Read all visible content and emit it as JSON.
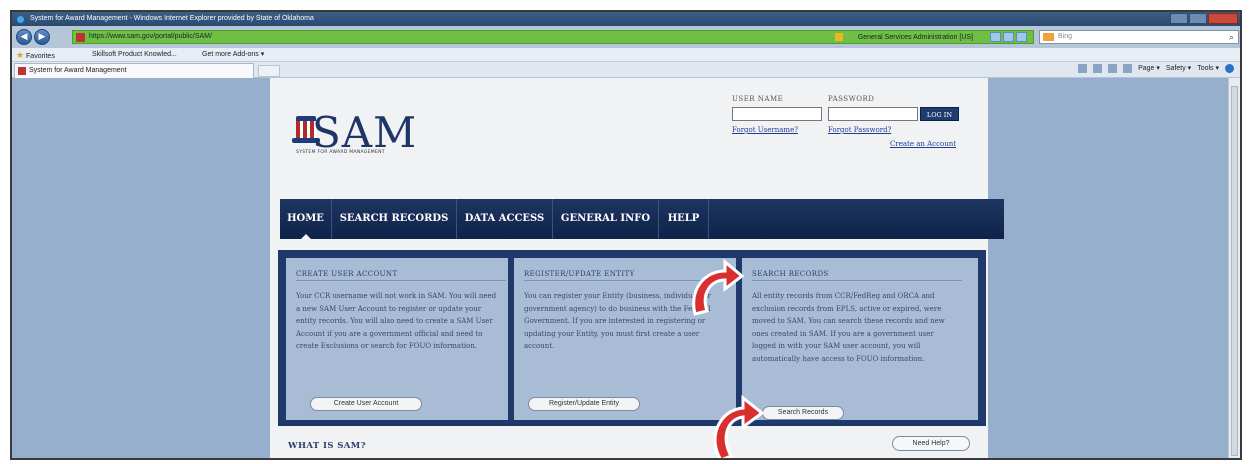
{
  "browser": {
    "title": "System for Award Management - Windows Internet Explorer provided by State of Oklahoma",
    "url": "https://www.sam.gov/portal/public/SAM/",
    "cert_label": "General Services Administration [US]",
    "search_placeholder": "Bing",
    "favorites_label": "Favorites",
    "favorites_items": [
      "Skillsoft Product Knowled...",
      "Get more Add-ons ▾"
    ],
    "tab_title": "System for Award Management",
    "commands": [
      "Page ▾",
      "Safety ▾",
      "Tools ▾"
    ]
  },
  "site": {
    "logo_text": "SAM",
    "logo_subtitle": "SYSTEM FOR AWARD MANAGEMENT",
    "username_label": "USER NAME",
    "password_label": "PASSWORD",
    "login_button": "LOG IN",
    "forgot_username": "Forgot Username?",
    "forgot_password": "Forgot Password?",
    "create_account_link": "Create an Account",
    "nav": [
      "HOME",
      "SEARCH RECORDS",
      "DATA ACCESS",
      "GENERAL INFO",
      "HELP"
    ],
    "columns": [
      {
        "heading": "CREATE USER ACCOUNT",
        "body": "Your CCR username will not work in SAM. You will need a new SAM User Account to register or update your entity records. You will also need to create a SAM User Account if you are a government official and need to create Exclusions or search for FOUO information.",
        "button": "Create User Account"
      },
      {
        "heading": "REGISTER/UPDATE ENTITY",
        "body": "You can register your Entity (business, individual, or government agency) to do business with the Federal Government. If you are interested in registering or updating your Entity, you must first create a user account.",
        "button": "Register/Update Entity"
      },
      {
        "heading": "SEARCH RECORDS",
        "body": "All entity records from CCR/FedReg and ORCA and exclusion records from EPLS, active or expired, were moved to SAM. You can search these records and new ones created in SAM. If you are a government user logged in with your SAM user account, you will automatically have access to FOUO information.",
        "button": "Search Records"
      }
    ],
    "what_is_sam": "WHAT IS SAM?",
    "need_help": "Need Help?"
  },
  "colors": {
    "navy": "#1e3563",
    "panel_blue": "#a8bcd5",
    "arrow_red": "#d9302f"
  }
}
